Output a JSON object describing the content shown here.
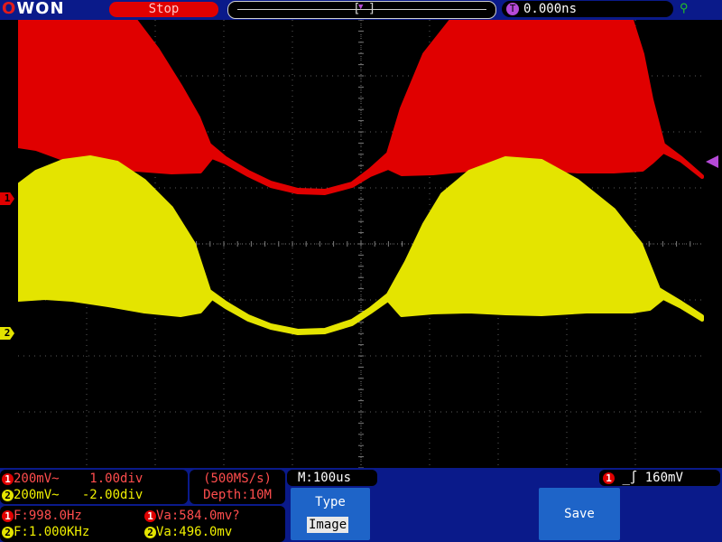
{
  "header": {
    "logo": "OWON",
    "run_state": "Stop",
    "trigger_time": "0.000ns",
    "trigger_marker": "T"
  },
  "markers": {
    "ch1": "1",
    "ch2": "2"
  },
  "channels": [
    {
      "id": "1",
      "volts_div": "200mV~",
      "offset": "1.00div",
      "color": "#e00000"
    },
    {
      "id": "2",
      "volts_div": "200mV~",
      "offset": "-2.00div",
      "color": "#e4e400"
    }
  ],
  "acquisition": {
    "sample_rate": "(500MS/s)",
    "depth": "Depth:10M"
  },
  "measurements": [
    {
      "ch": "1",
      "freq": "F:998.0Hz",
      "va": "Va:584.0mv?"
    },
    {
      "ch": "2",
      "freq": "F:1.000KHz",
      "va": "Va:496.0mv"
    }
  ],
  "timebase": "M:100us",
  "trigger": {
    "source": "1",
    "slope_icon": "rising-edge-icon",
    "level": "160mV"
  },
  "menu": {
    "type_label": "Type",
    "type_value": "Image",
    "save_label": "Save"
  },
  "colors": {
    "panel": "#0a1a8a",
    "button": "#1e64c8",
    "ch1": "#e00000",
    "ch2": "#e4e400",
    "trigger": "#b64ad8",
    "grid": "#808080"
  }
}
